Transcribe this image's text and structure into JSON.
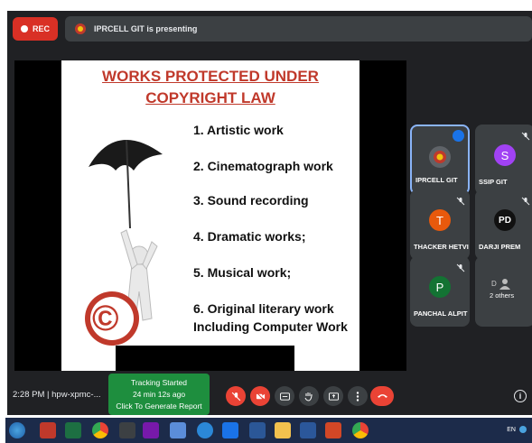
{
  "meet": {
    "rec_label": "REC",
    "presenting_text": "IPRCELL GIT is presenting"
  },
  "slide": {
    "title_line1": "WORKS PROTECTED UNDER",
    "title_line2": "COPYRIGHT LAW",
    "items": [
      "1. Artistic work",
      "2. Cinematograph work",
      "3. Sound recording",
      "4. Dramatic works;",
      "5. Musical work;",
      "6. Original literary work",
      "Including Computer Work"
    ],
    "copyright_symbol": "©"
  },
  "participants": [
    {
      "name": "IPRCELL GIT",
      "initial": "",
      "color": "#5f6368",
      "speaking": true
    },
    {
      "name": "SSIP GIT",
      "initial": "S",
      "color": "#a142f4",
      "speaking": false
    },
    {
      "name": "THACKER HETVI",
      "initial": "T",
      "color": "#e8590c",
      "speaking": false
    },
    {
      "name": "DARJI PREM",
      "initial": "PD",
      "color": "#111111",
      "speaking": false
    },
    {
      "name": "PANCHAL ALPIT",
      "initial": "P",
      "color": "#137333",
      "speaking": false
    },
    {
      "name": "2 others",
      "initial": "D",
      "color": "#3c4043",
      "speaking": false
    }
  ],
  "bottombar": {
    "time_meeting": "2:28 PM  |  hpw-xpmc-...",
    "tracking_line1": "Tracking Started",
    "tracking_line2": "24 min 12s ago",
    "tracking_line3": "Click To Generate Report",
    "info_glyph": "i"
  },
  "taskbar": {
    "tray_text": "EN"
  }
}
